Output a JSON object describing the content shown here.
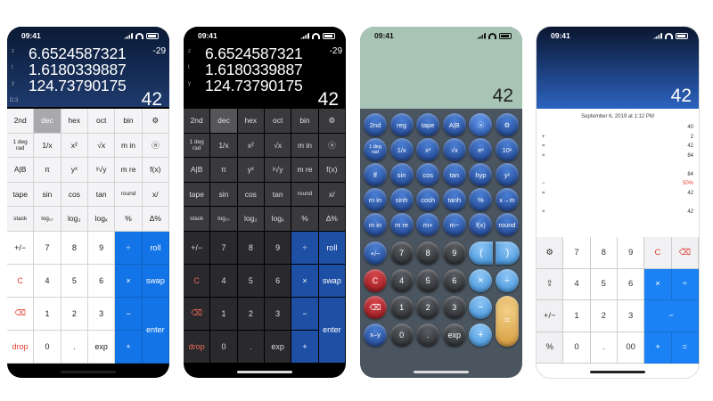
{
  "status": {
    "time": "09:41"
  },
  "rpn": {
    "stack": [
      {
        "reg": "z",
        "value": "6.6524587321"
      },
      {
        "reg": "t",
        "value": "1.6180339887"
      },
      {
        "reg": "y",
        "value": "124.73790175"
      }
    ],
    "exponent": "-29",
    "x": "42",
    "depth_label": "D:3",
    "depth_arrow": "⇡"
  },
  "keys_rpn": {
    "row1": [
      "2nd",
      "dec",
      "hex",
      "oct",
      "bin",
      "⚙"
    ],
    "row2": [
      "1 deg\nrad",
      "1/x",
      "x²",
      "√x",
      "m in",
      "ⓐ"
    ],
    "row3": [
      "A|B",
      "π",
      "yˣ",
      "ʸ√y",
      "m re",
      "f(x)"
    ],
    "row4": [
      "tape",
      "sin",
      "cos",
      "tan",
      "round",
      "x/"
    ],
    "row5": [
      "stack",
      "log₁₀",
      "log₂",
      "logₓ",
      "%",
      "Δ%"
    ],
    "num": {
      "plusminus": "+/−",
      "c": "C",
      "back": "⌫",
      "drop": "drop",
      "n7": "7",
      "n8": "8",
      "n9": "9",
      "n4": "4",
      "n5": "5",
      "n6": "6",
      "n1": "1",
      "n2": "2",
      "n3": "3",
      "n0": "0",
      "dot": ".",
      "exp": "exp",
      "div": "÷",
      "mul": "×",
      "minus": "−",
      "plus": "+",
      "roll": "roll",
      "swap": "swap",
      "enter": "enter"
    }
  },
  "phone3": {
    "x": "42",
    "row1": [
      "2nd",
      "reg",
      "tape",
      "A|B",
      "ⓐ",
      "⚙"
    ],
    "row2": [
      "1 deg\nrad",
      "1/x",
      "x²",
      "√x",
      "eˣ",
      "10ˣ"
    ],
    "row3": [
      "ff",
      "sin",
      "cos",
      "tan",
      "hyp",
      "yˣ"
    ],
    "row4": [
      "m in",
      "sinh",
      "cosh",
      "tanh",
      "%",
      "x→m"
    ],
    "row5": [
      "m in",
      "m re",
      "m+",
      "m−",
      "f(x)",
      "round"
    ],
    "num": {
      "plusminus": "+/−",
      "n7": "7",
      "n8": "8",
      "n9": "9",
      "paren_open": "(",
      "paren_close": ")",
      "c": "C",
      "n4": "4",
      "n5": "5",
      "n6": "6",
      "mul": "×",
      "div": "÷",
      "back": "⌫",
      "n1": "1",
      "n2": "2",
      "n3": "3",
      "minus": "−",
      "eq": "=",
      "xy": "x–y",
      "n0": "0",
      "dot": ".",
      "exp": "exp",
      "plus": "+"
    }
  },
  "phone4": {
    "x": "42",
    "tape_date": "September 6, 2019 at 1:12 PM",
    "tape": [
      {
        "op": "",
        "val": "40",
        "color": "#333"
      },
      {
        "op": "+",
        "val": "2",
        "color": "#333"
      },
      {
        "op": "=",
        "val": "42",
        "color": "#333"
      },
      {
        "op": "×",
        "val": "84",
        "color": "#333"
      },
      {
        "op": "",
        "val": "",
        "color": "#333"
      },
      {
        "op": "",
        "val": "84",
        "color": "#333"
      },
      {
        "op": "−",
        "val": "50%",
        "color": "#e53b30"
      },
      {
        "op": "=",
        "val": "42",
        "color": "#333"
      },
      {
        "op": "",
        "val": "",
        "color": "#333"
      },
      {
        "op": "×",
        "val": "42",
        "color": "#333"
      }
    ],
    "keys": {
      "gear": "⚙",
      "n7": "7",
      "n8": "8",
      "n9": "9",
      "c": "C",
      "back": "⌫",
      "share": "⇪",
      "n4": "4",
      "n5": "5",
      "n6": "6",
      "mul": "×",
      "div": "÷",
      "plusminus": "+/−",
      "n1": "1",
      "n2": "2",
      "n3": "3",
      "minus": "−",
      "percent": "%",
      "n0": "0",
      "dot": ".",
      "dblzero": "00",
      "plus": "+",
      "eq": "="
    }
  }
}
